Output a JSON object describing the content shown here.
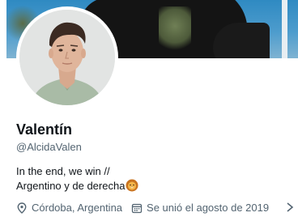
{
  "profile": {
    "name": "Valentín",
    "handle": "@AlcidaValen",
    "bio_line1": "In the end, we win //",
    "bio_line2": "Argentino y de derecha",
    "bio_emoji": "lion-face-emoji"
  },
  "meta": {
    "location": "Córdoba, Argentina",
    "location_icon": "location-pin-icon",
    "joined": "Se unió el agosto de 2019",
    "joined_icon": "calendar-icon",
    "more_icon": "chevron-right-icon"
  },
  "colors": {
    "text_primary": "#0f1419",
    "text_secondary": "#536471",
    "banner_sky": "#3a8fc5"
  }
}
